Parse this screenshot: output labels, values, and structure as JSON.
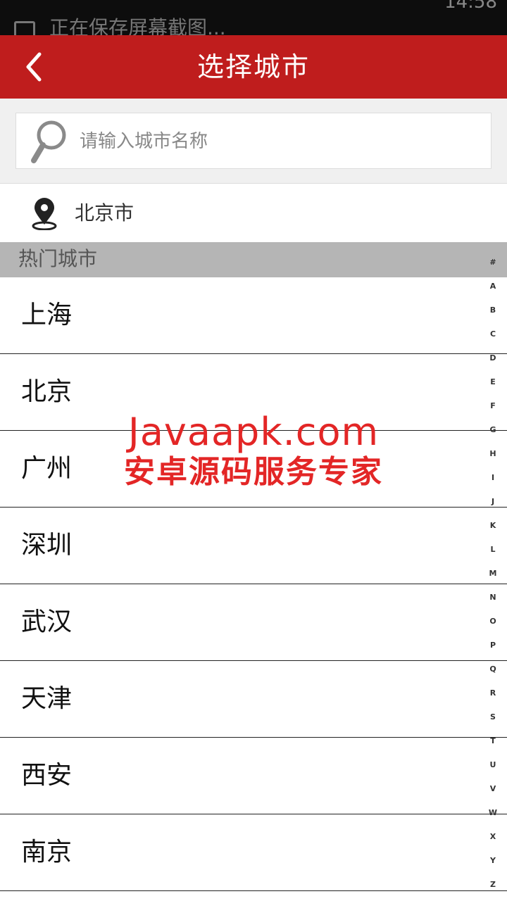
{
  "status_bar": {
    "notification_text": "正在保存屏幕截图...",
    "time": "14:58"
  },
  "header": {
    "title": "选择城市",
    "back_icon": "chevron-left-icon"
  },
  "search": {
    "placeholder": "请输入城市名称",
    "value": "",
    "icon": "search-icon"
  },
  "location": {
    "icon": "location-pin-icon",
    "city": "北京市"
  },
  "hot_section": {
    "title": "热门城市"
  },
  "cities": [
    "上海",
    "北京",
    "广州",
    "深圳",
    "武汉",
    "天津",
    "西安",
    "南京"
  ],
  "index_letters": [
    "#",
    "A",
    "B",
    "C",
    "D",
    "E",
    "F",
    "G",
    "H",
    "I",
    "J",
    "K",
    "L",
    "M",
    "N",
    "O",
    "P",
    "Q",
    "R",
    "S",
    "T",
    "U",
    "V",
    "W",
    "X",
    "Y",
    "Z"
  ],
  "watermark": {
    "line1": "Javaapk.com",
    "line2": "安卓源码服务专家"
  },
  "colors": {
    "title_bar": "#bf1d1d",
    "section_header": "#b5b5b5",
    "watermark": "#e32626"
  }
}
